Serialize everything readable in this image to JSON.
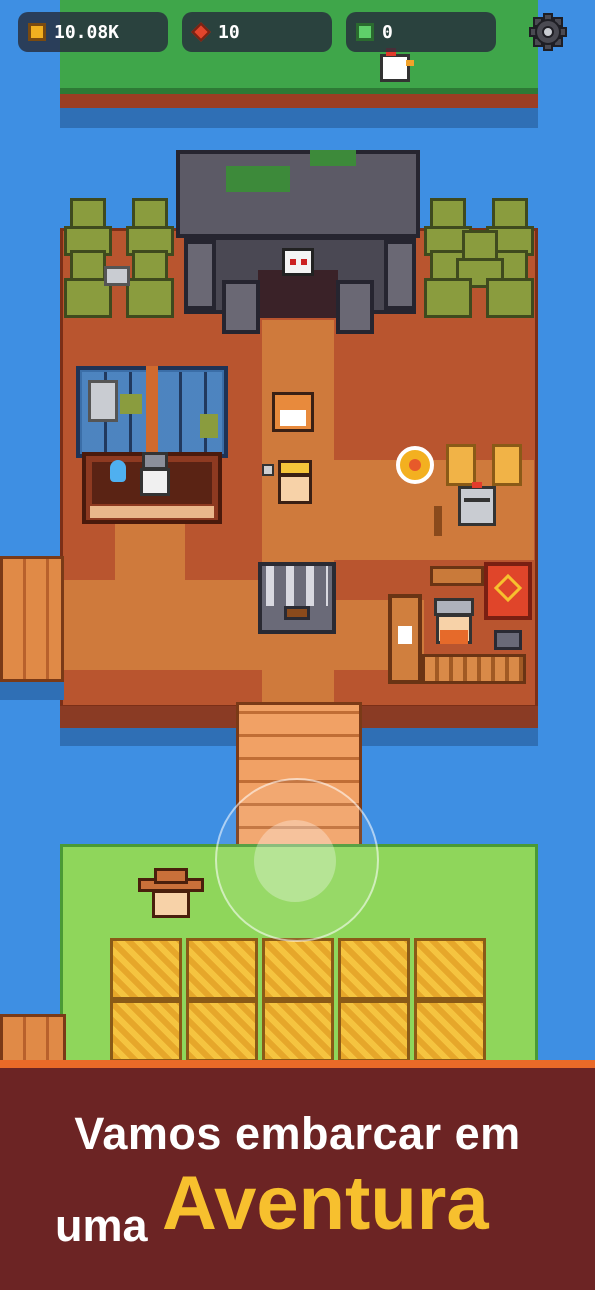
{
  "hud": {
    "gold": "10.08K",
    "gems": "10",
    "emeralds": "0",
    "gold_icon": "gold-coin-icon",
    "gem_icon": "red-gem-icon",
    "emerald_icon": "green-emerald-icon",
    "settings_icon": "gear-icon"
  },
  "tagline": {
    "line1": "Vamos embarcar em",
    "line2_prefix": "uma",
    "line2_highlight": "Aventura"
  },
  "colors": {
    "banner_bg": "#6c2424",
    "banner_accent": "#ea6a28",
    "highlight_text": "#f7c02e",
    "water": "#3e8fe3"
  },
  "characters": [
    "chicken",
    "cat",
    "hero",
    "wizard",
    "knight",
    "viking-blacksmith",
    "farmer"
  ],
  "props": [
    "temple-ruins",
    "skull",
    "treasure-chest",
    "archery-target",
    "training-dummies",
    "red-banner",
    "weapon-rack",
    "wheat-field",
    "wooden-bridge",
    "wooden-dock",
    "greenhouse"
  ]
}
